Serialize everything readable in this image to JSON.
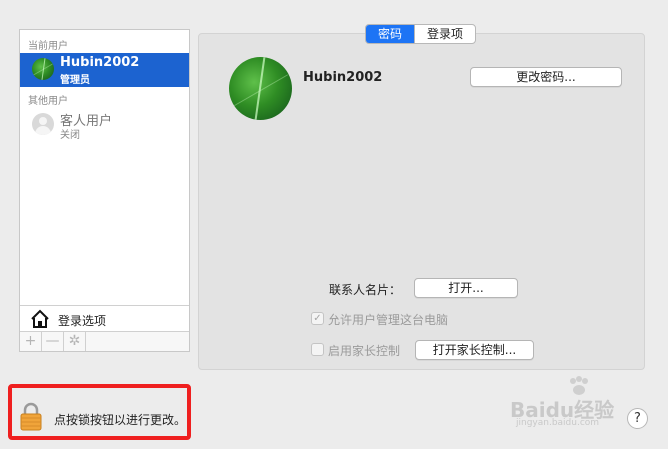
{
  "sidebar": {
    "current_users_label": "当前用户",
    "other_users_label": "其他用户",
    "users": [
      {
        "name": "Hubin2002",
        "role": "管理员",
        "selected": true
      },
      {
        "name": "客人用户",
        "role": "关闭",
        "selected": false
      }
    ],
    "login_options_label": "登录选项",
    "tools": {
      "add": "+",
      "remove": "—",
      "settings": "✲"
    }
  },
  "tabs": [
    {
      "label": "密码",
      "active": true
    },
    {
      "label": "登录项",
      "active": false
    }
  ],
  "profile": {
    "name": "Hubin2002",
    "change_password_button": "更改密码..."
  },
  "contact_card": {
    "label": "联系人名片：",
    "open_button": "打开..."
  },
  "options": {
    "allow_admin_label": "允许用户管理这台电脑",
    "allow_admin_checked": true,
    "parental_controls_label": "启用家长控制",
    "parental_controls_checked": false,
    "open_parental_controls_button": "打开家长控制..."
  },
  "lock": {
    "message": "点按锁按钮以进行更改。"
  },
  "help": "?",
  "watermark": {
    "brand": "Baidu经验",
    "url": "jingyan.baidu.com"
  },
  "colors": {
    "selection": "#1c63d0",
    "tab_active": "#1d74f5",
    "highlight_frame": "#ef1f1f"
  }
}
